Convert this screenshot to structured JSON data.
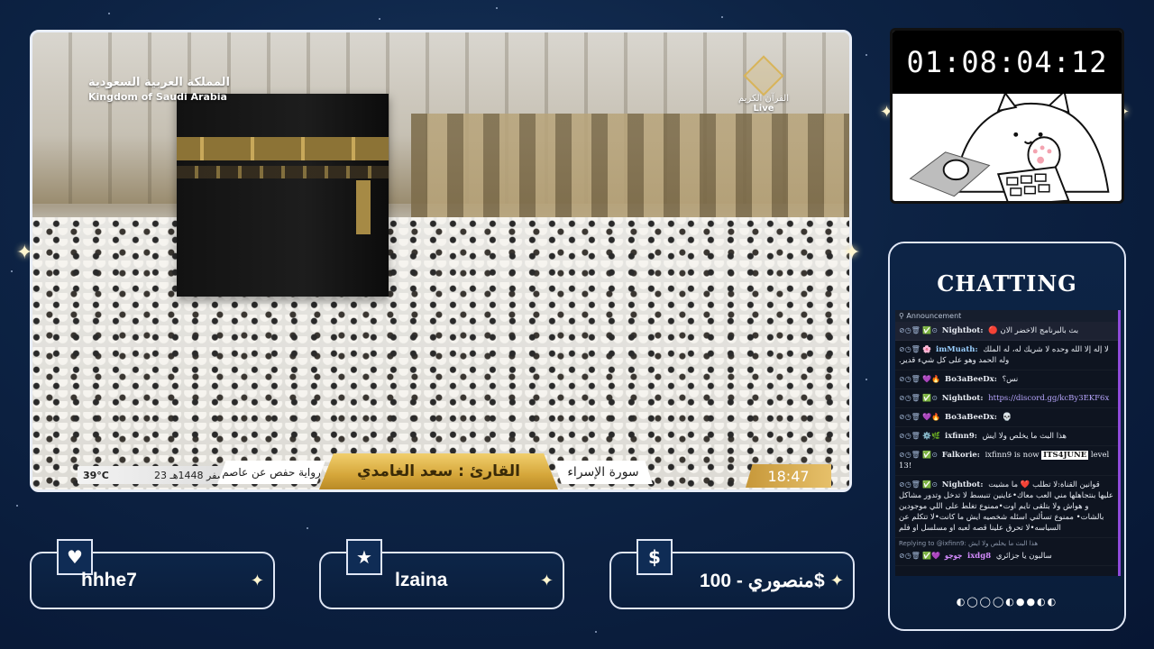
{
  "stream": {
    "channel_ar": "المملكة العربية السعودية",
    "channel_en": "Kingdom of Saudi Arabia",
    "logo_ar": "القرآن الكريم",
    "logo_live": "Live",
    "temperature": "39°C",
    "hijri_date": "23 صفر 1448هـ",
    "riwaya": "رواية حفص عن عاصم",
    "reader": "القارئ : سعد الغامدي",
    "surah": "سورة الإسراء",
    "clock": "18:47"
  },
  "timer": {
    "value": "01:08:04:12"
  },
  "chat": {
    "title": "CHATTING",
    "announcement_label": "Announcement",
    "messages": [
      {
        "user": "Nightbot:",
        "user_color": "#ffffff",
        "text": "بث بالبرنامج الاخضر الان 🔴",
        "highlight": true
      },
      {
        "user": "imMuath:",
        "user_color": "#9ad0ff",
        "text": "لا إله إلا الله وحده لا شريك له، له الملك وله الحمد وهو على كل شيء قدير."
      },
      {
        "user": "Bo3aBeeDx:",
        "user_color": "#ffffff",
        "text": "نس؟"
      },
      {
        "user": "Nightbot:",
        "user_color": "#ffffff",
        "text": "https://discord.gg/kcBy3EKF6x",
        "is_link": true
      },
      {
        "user": "Bo3aBeeDx:",
        "user_color": "#ffffff",
        "text": "💀"
      },
      {
        "user": "ixfinn9:",
        "user_color": "#ffffff",
        "text": "هذا البث ما يخلص ولا ايش"
      },
      {
        "user": "Falkorie:",
        "user_color": "#ffffff",
        "text_pre": "ixfinn9 is now",
        "tag": "ITS4JUNE",
        "text_post": "level 13!"
      },
      {
        "user": "Nightbot:",
        "user_color": "#ffffff",
        "text": "قوانين القناة:لا تطلب ❤️ ما مشيت عليها بنتجاهلها مني العب معاك•عاينين تنبسط لا تدخل وتدور مشاكل و هواش ولا بتلقى تايم اوت•ممنوع تغلط على اللي موجودين بالشات• ممنوع تسألني اسئله شخصيه ايش ما كانت•لا تتكلم عن السياسه•لا تحرق علينا قصه لعبه او مسلسل او فلم"
      },
      {
        "reply": "Replying to @ixfinn9: هذا البث ما يخلص ولا ايش",
        "user": "ixdg8",
        "user_prefix": "جوجو",
        "user_color": "#d58cff",
        "text": "سالبون يا جزائري"
      }
    ],
    "dots": "◐◯◯◯◐●●◐◐"
  },
  "cards": [
    {
      "icon": "heart-icon",
      "icon_glyph": "♥",
      "label": "hhhe7"
    },
    {
      "icon": "star-icon",
      "icon_glyph": "★",
      "label": "lzaina"
    },
    {
      "icon": "dollar-icon",
      "icon_glyph": "$",
      "label": "منصوري - 100$"
    }
  ]
}
